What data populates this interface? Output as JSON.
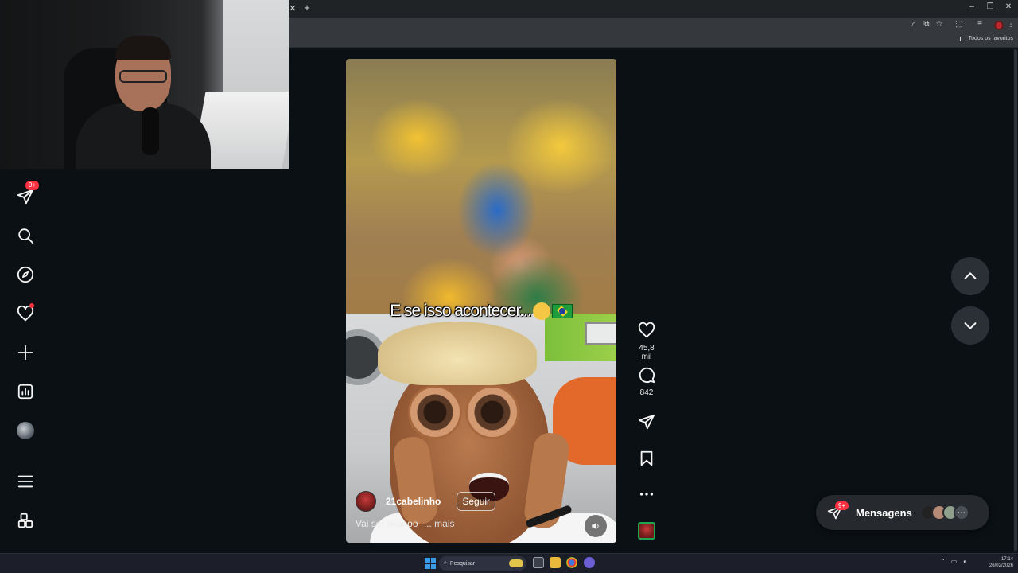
{
  "browser": {
    "bookmarks_folder": "Todos os favoritos"
  },
  "sidebar": {
    "items": [
      {
        "icon": "direct-messages-icon",
        "badge": "9+"
      },
      {
        "icon": "search-icon"
      },
      {
        "icon": "explore-compass-icon"
      },
      {
        "icon": "notifications-heart-icon"
      },
      {
        "icon": "create-plus-icon"
      },
      {
        "icon": "dashboard-icon"
      },
      {
        "icon": "profile-avatar"
      },
      {
        "icon": "menu-icon"
      },
      {
        "icon": "apps-icon"
      }
    ]
  },
  "reel": {
    "overlay_text": "E se isso acontecer...",
    "author": "21cabelinho",
    "follow_label": "Seguir",
    "caption": "Vai ser lindooo",
    "caption_more": "... mais",
    "likes": "45,8 mil",
    "comments": "842"
  },
  "messages": {
    "label": "Mensagens",
    "badge": "9+"
  },
  "taskbar": {
    "search_placeholder": "Pesquisar",
    "time": "17:14",
    "date": "26/02/2026"
  },
  "colors": {
    "background": "#0b1014",
    "badge": "#ff3040",
    "pill": "#262a2e",
    "nav_button": "#2b3036"
  }
}
